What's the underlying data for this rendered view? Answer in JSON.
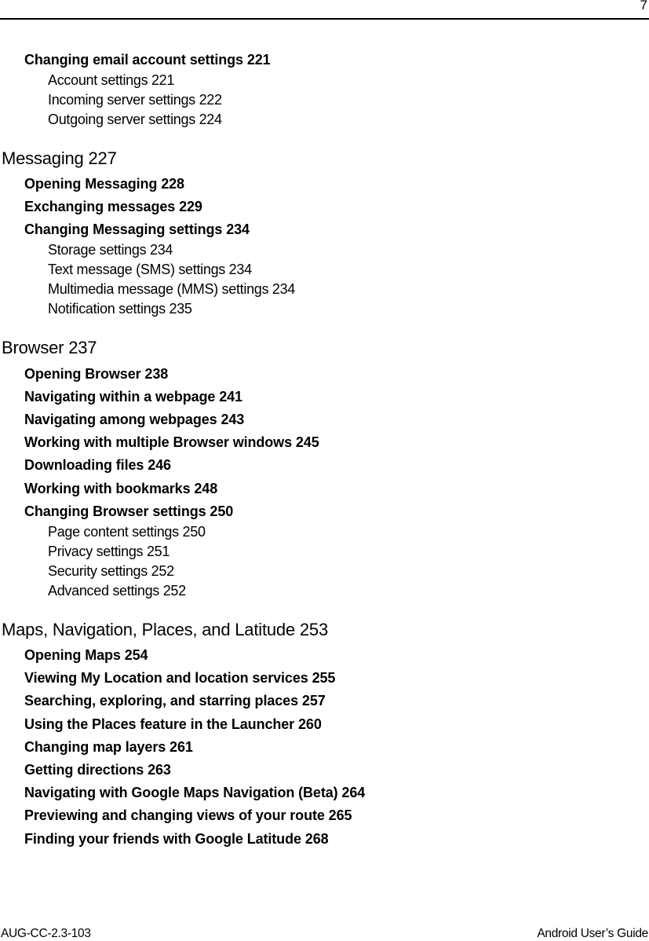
{
  "header": {
    "page_number": "7"
  },
  "toc": [
    {
      "level": 2,
      "text": "Changing email account settings 221"
    },
    {
      "level": 3,
      "text": "Account settings 221"
    },
    {
      "level": 3,
      "text": "Incoming server settings 222"
    },
    {
      "level": 3,
      "text": "Outgoing server settings 224"
    },
    {
      "level": 1,
      "text": "Messaging 227"
    },
    {
      "level": 2,
      "text": "Opening Messaging 228"
    },
    {
      "level": 2,
      "text": "Exchanging messages 229"
    },
    {
      "level": 2,
      "text": "Changing Messaging settings 234"
    },
    {
      "level": 3,
      "text": "Storage settings 234"
    },
    {
      "level": 3,
      "text": "Text message (SMS) settings 234"
    },
    {
      "level": 3,
      "text": "Multimedia message (MMS) settings 234"
    },
    {
      "level": 3,
      "text": "Notification settings 235"
    },
    {
      "level": 1,
      "text": "Browser 237"
    },
    {
      "level": 2,
      "text": "Opening Browser 238"
    },
    {
      "level": 2,
      "text": "Navigating within a webpage 241"
    },
    {
      "level": 2,
      "text": "Navigating among webpages 243"
    },
    {
      "level": 2,
      "text": "Working with multiple Browser windows 245"
    },
    {
      "level": 2,
      "text": "Downloading files 246"
    },
    {
      "level": 2,
      "text": "Working with bookmarks 248"
    },
    {
      "level": 2,
      "text": "Changing Browser settings 250"
    },
    {
      "level": 3,
      "text": "Page content settings 250"
    },
    {
      "level": 3,
      "text": "Privacy settings 251"
    },
    {
      "level": 3,
      "text": "Security settings 252"
    },
    {
      "level": 3,
      "text": "Advanced settings 252"
    },
    {
      "level": 1,
      "text": "Maps, Navigation, Places, and Latitude 253"
    },
    {
      "level": 2,
      "text": "Opening Maps 254"
    },
    {
      "level": 2,
      "text": "Viewing My Location and location services 255"
    },
    {
      "level": 2,
      "text": "Searching, exploring, and starring places 257"
    },
    {
      "level": 2,
      "text": "Using the Places feature in the Launcher 260"
    },
    {
      "level": 2,
      "text": "Changing map layers 261"
    },
    {
      "level": 2,
      "text": "Getting directions 263"
    },
    {
      "level": 2,
      "text": "Navigating with Google Maps Navigation (Beta) 264"
    },
    {
      "level": 2,
      "text": "Previewing and changing views of your route 265"
    },
    {
      "level": 2,
      "text": "Finding your friends with Google Latitude 268"
    }
  ],
  "footer": {
    "document_code": "AUG-CC-2.3-103",
    "document_title": "Android User’s Guide"
  }
}
